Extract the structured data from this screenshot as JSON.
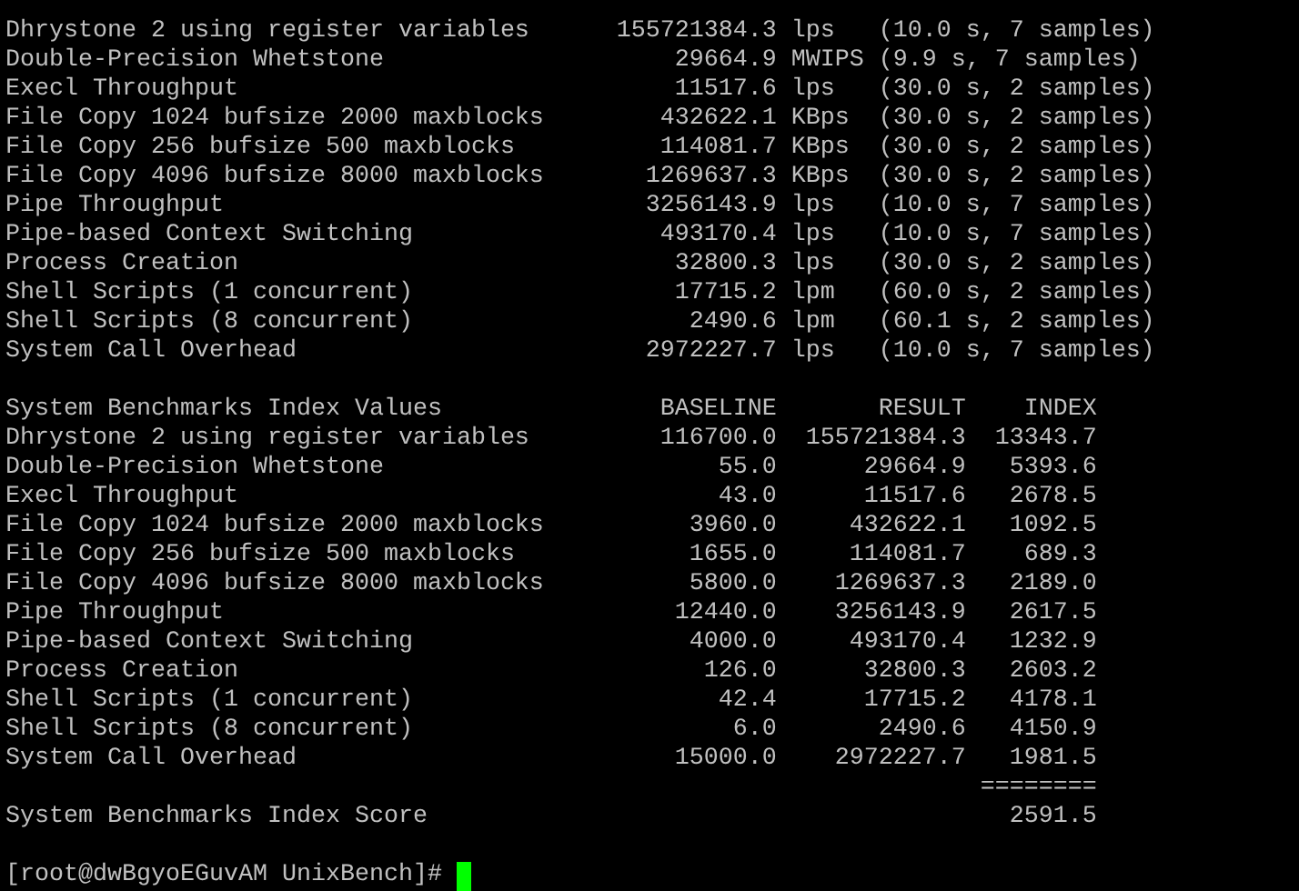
{
  "results": [
    {
      "name": "Dhrystone 2 using register variables",
      "value": "155721384.3",
      "unit": "lps",
      "timing": "(10.0 s, 7 samples)"
    },
    {
      "name": "Double-Precision Whetstone",
      "value": "29664.9",
      "unit": "MWIPS",
      "timing": "(9.9 s, 7 samples)"
    },
    {
      "name": "Execl Throughput",
      "value": "11517.6",
      "unit": "lps",
      "timing": "(30.0 s, 2 samples)"
    },
    {
      "name": "File Copy 1024 bufsize 2000 maxblocks",
      "value": "432622.1",
      "unit": "KBps",
      "timing": "(30.0 s, 2 samples)"
    },
    {
      "name": "File Copy 256 bufsize 500 maxblocks",
      "value": "114081.7",
      "unit": "KBps",
      "timing": "(30.0 s, 2 samples)"
    },
    {
      "name": "File Copy 4096 bufsize 8000 maxblocks",
      "value": "1269637.3",
      "unit": "KBps",
      "timing": "(30.0 s, 2 samples)"
    },
    {
      "name": "Pipe Throughput",
      "value": "3256143.9",
      "unit": "lps",
      "timing": "(10.0 s, 7 samples)"
    },
    {
      "name": "Pipe-based Context Switching",
      "value": "493170.4",
      "unit": "lps",
      "timing": "(10.0 s, 7 samples)"
    },
    {
      "name": "Process Creation",
      "value": "32800.3",
      "unit": "lps",
      "timing": "(30.0 s, 2 samples)"
    },
    {
      "name": "Shell Scripts (1 concurrent)",
      "value": "17715.2",
      "unit": "lpm",
      "timing": "(60.0 s, 2 samples)"
    },
    {
      "name": "Shell Scripts (8 concurrent)",
      "value": "2490.6",
      "unit": "lpm",
      "timing": "(60.1 s, 2 samples)"
    },
    {
      "name": "System Call Overhead",
      "value": "2972227.7",
      "unit": "lps",
      "timing": "(10.0 s, 7 samples)"
    }
  ],
  "index_table": {
    "title": "System Benchmarks Index Values",
    "columns": [
      "BASELINE",
      "RESULT",
      "INDEX"
    ],
    "rows": [
      {
        "name": "Dhrystone 2 using register variables",
        "baseline": "116700.0",
        "result": "155721384.3",
        "index": "13343.7"
      },
      {
        "name": "Double-Precision Whetstone",
        "baseline": "55.0",
        "result": "29664.9",
        "index": "5393.6"
      },
      {
        "name": "Execl Throughput",
        "baseline": "43.0",
        "result": "11517.6",
        "index": "2678.5"
      },
      {
        "name": "File Copy 1024 bufsize 2000 maxblocks",
        "baseline": "3960.0",
        "result": "432622.1",
        "index": "1092.5"
      },
      {
        "name": "File Copy 256 bufsize 500 maxblocks",
        "baseline": "1655.0",
        "result": "114081.7",
        "index": "689.3"
      },
      {
        "name": "File Copy 4096 bufsize 8000 maxblocks",
        "baseline": "5800.0",
        "result": "1269637.3",
        "index": "2189.0"
      },
      {
        "name": "Pipe Throughput",
        "baseline": "12440.0",
        "result": "3256143.9",
        "index": "2617.5"
      },
      {
        "name": "Pipe-based Context Switching",
        "baseline": "4000.0",
        "result": "493170.4",
        "index": "1232.9"
      },
      {
        "name": "Process Creation",
        "baseline": "126.0",
        "result": "32800.3",
        "index": "2603.2"
      },
      {
        "name": "Shell Scripts (1 concurrent)",
        "baseline": "42.4",
        "result": "17715.2",
        "index": "4178.1"
      },
      {
        "name": "Shell Scripts (8 concurrent)",
        "baseline": "6.0",
        "result": "2490.6",
        "index": "4150.9"
      },
      {
        "name": "System Call Overhead",
        "baseline": "15000.0",
        "result": "2972227.7",
        "index": "1981.5"
      }
    ],
    "separator": "========",
    "score_label": "System Benchmarks Index Score",
    "score": "2591.5"
  },
  "prompt": "[root@dwBgyoEGuvAM UnixBench]#"
}
